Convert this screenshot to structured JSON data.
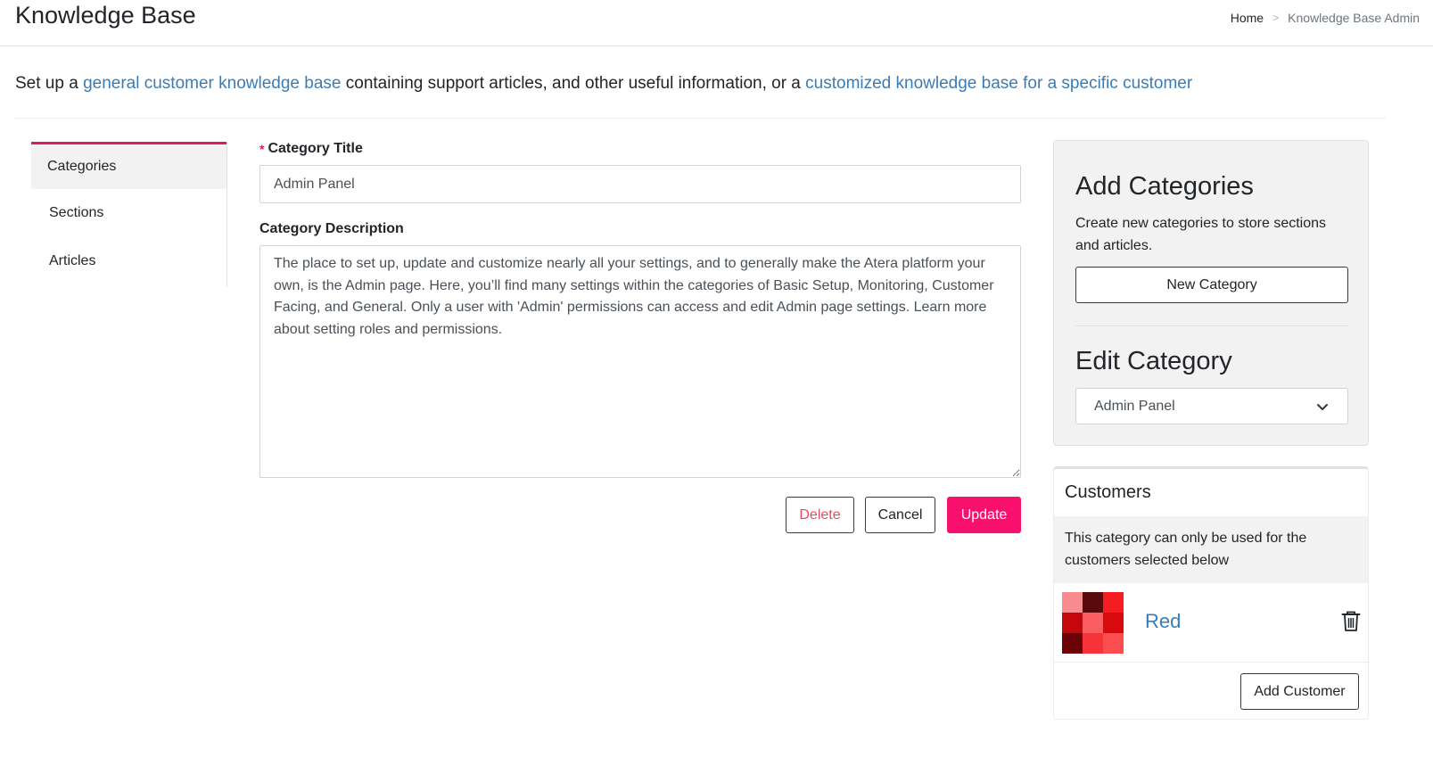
{
  "header": {
    "title": "Knowledge Base",
    "breadcrumb": {
      "home": "Home",
      "separator": ">",
      "current": "Knowledge Base Admin"
    }
  },
  "intro": {
    "part1": "Set up a ",
    "link1": "general customer knowledge base",
    "part2": " containing support articles, and other useful information, or a ",
    "link2": "customized knowledge base for a specific customer"
  },
  "sidebar": {
    "items": [
      {
        "label": "Categories",
        "active": true
      },
      {
        "label": "Sections",
        "active": false
      },
      {
        "label": "Articles",
        "active": false
      }
    ]
  },
  "form": {
    "required_mark": "*",
    "title_label": "Category Title",
    "title_value": "Admin Panel",
    "description_label": "Category Description",
    "description_value": "The place to set up, update and customize nearly all your settings, and to generally make the Atera platform your own, is the Admin page. Here, you’ll find many settings within the categories of Basic Setup, Monitoring, Customer Facing, and General. Only a user with 'Admin' permissions can access and edit Admin page settings. Learn more about setting roles and permissions.",
    "buttons": {
      "delete": "Delete",
      "cancel": "Cancel",
      "update": "Update"
    }
  },
  "add_categories": {
    "heading": "Add Categories",
    "text": "Create new categories to store sections and articles.",
    "new_button": "New Category"
  },
  "edit_category": {
    "heading": "Edit Category",
    "selected": "Admin Panel"
  },
  "customers": {
    "title": "Customers",
    "note": "This category can only be used for the customers selected below",
    "items": [
      {
        "name": "Red",
        "avatar_colors": [
          "#f98a8e",
          "#5a0a0a",
          "#f51c22",
          "#c4070d",
          "#fa5e62",
          "#d70a0f",
          "#6b0306",
          "#f53339",
          "#fb4c50"
        ]
      }
    ],
    "add_button": "Add Customer"
  },
  "colors": {
    "accent": "#f7116c",
    "link": "#3a7db5",
    "danger_text": "#e84b5c",
    "panel_bg": "#f2f2f2"
  },
  "icons": {
    "delete_customer": "trash-icon",
    "select_arrow": "chevron-down-icon",
    "required": "asterisk-icon"
  }
}
